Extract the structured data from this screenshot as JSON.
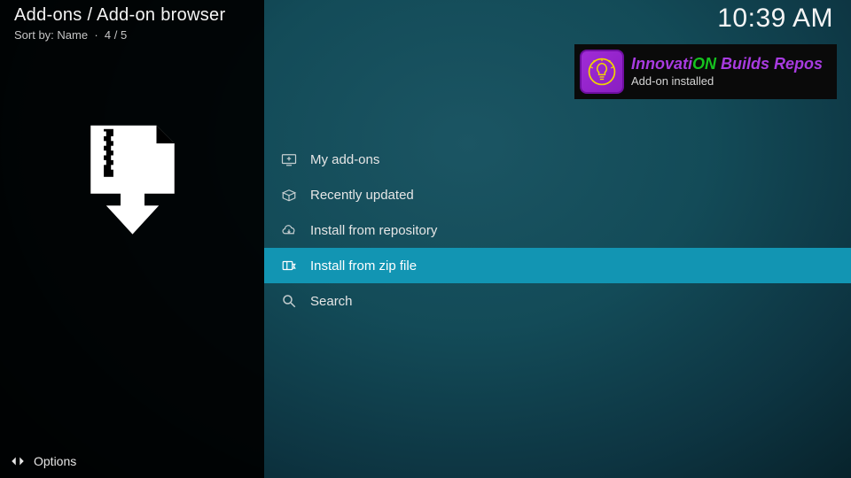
{
  "header": {
    "breadcrumb": "Add-ons / Add-on browser",
    "sort_label": "Sort by: Name",
    "position": "4 / 5",
    "clock": "10:39 AM"
  },
  "menu": {
    "items": [
      {
        "label": "My add-ons",
        "icon": "tv-plus-icon",
        "selected": false
      },
      {
        "label": "Recently updated",
        "icon": "open-box-icon",
        "selected": false
      },
      {
        "label": "Install from repository",
        "icon": "cloud-download-icon",
        "selected": false
      },
      {
        "label": "Install from zip file",
        "icon": "zip-package-icon",
        "selected": true
      },
      {
        "label": "Search",
        "icon": "search-icon",
        "selected": false
      }
    ]
  },
  "toast": {
    "title_part1": "Innovati",
    "title_part2": "ON",
    "title_part3": " Builds Repos",
    "subtitle": "Add-on installed",
    "icon": "lightbulb-icon"
  },
  "footer": {
    "options_label": "Options"
  },
  "colors": {
    "highlight": "#1295b3",
    "toast_purple": "#a83be0",
    "toast_green": "#16c21f"
  }
}
